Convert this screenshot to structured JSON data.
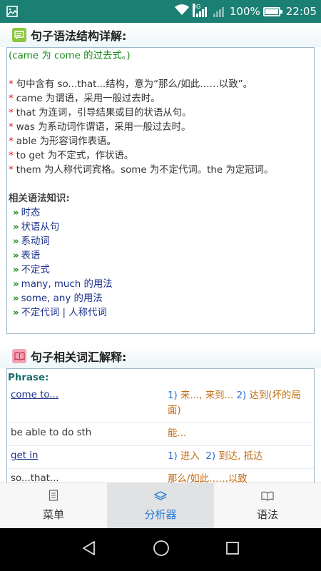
{
  "status_bar": {
    "network_type": "3G",
    "battery_percent_label": "100%",
    "battery_level": 1.0,
    "time": "22:05"
  },
  "grammar_section": {
    "title": "句子语法结构详解:",
    "icon": "chat-bubble-icon",
    "intro": "(came 为 come 的过去式。)",
    "bullets": [
      "句中含有 so...that...结构，意为“那么/如此……以致”。",
      "came 为谓语，采用一般过去时。",
      "that 为连词，引导结果或目的状语从句。",
      "was 为系动词作谓语，采用一般过去时。",
      "able 为形容词作表语。",
      "to get 为不定式，作状语。",
      "them 为人称代词宾格。some 为不定代词。the 为定冠词。"
    ],
    "related_heading": "相关语法知识:",
    "related_links": [
      "时态",
      "状语从句",
      "系动词",
      "表语",
      "不定式",
      "many, much 的用法",
      "some, any 的用法",
      "不定代词 | 人称代词"
    ]
  },
  "vocab_section": {
    "title": "句子相关词汇解释:",
    "icon": "book-icon",
    "phrase_heading": "Phrase:",
    "rows": [
      {
        "term": "come to...",
        "is_link": true,
        "defs": [
          {
            "num": "1)",
            "text": "来..., 来到..."
          },
          {
            "num": "2)",
            "text": "达到(坏的局面)"
          }
        ]
      },
      {
        "term": "be able to do sth",
        "is_link": false,
        "defs": [
          {
            "num": "",
            "text": "能..."
          }
        ]
      },
      {
        "term": "get in",
        "is_link": true,
        "defs": [
          {
            "num": "1)",
            "text": "进入"
          },
          {
            "num": "2)",
            "text": "到达, 抵达"
          }
        ]
      },
      {
        "term": "so...that...",
        "is_link": false,
        "defs": [
          {
            "num": "",
            "text": "那么/如此……以致"
          }
        ]
      }
    ]
  },
  "tabs": [
    {
      "label": "菜单",
      "icon": "document-icon",
      "active": false
    },
    {
      "label": "分析器",
      "icon": "layers-icon",
      "active": true
    },
    {
      "label": "语法",
      "icon": "open-book-icon",
      "active": false
    }
  ],
  "colors": {
    "status_bar": "#1c7f74",
    "active_tab": "#2a7cd1",
    "bullet_star": "#dd1111",
    "definition": "#c26b12",
    "link": "#1a2f8a"
  }
}
